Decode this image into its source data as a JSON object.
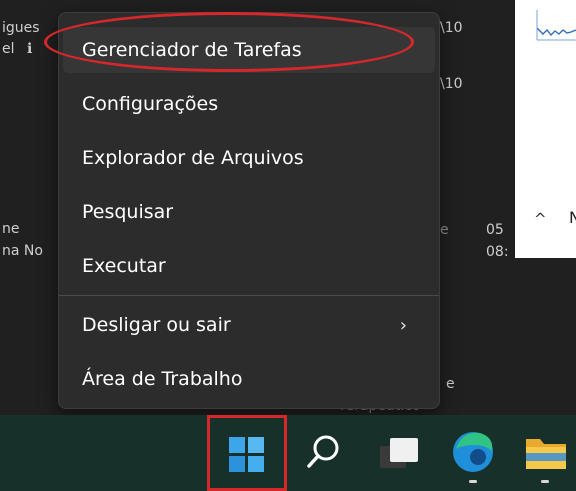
{
  "background": {
    "top_left_lines": [
      "igues",
      "el"
    ],
    "top_left_info_glyph": "ℹ",
    "mid_left_lines": [
      "ne",
      "na No"
    ],
    "path_fragments": [
      "\\10",
      "\\10"
    ],
    "right_fragments": [
      "e",
      "05",
      "08:"
    ],
    "bottom_fragments": [
      "e",
      "rerapeutico >"
    ]
  },
  "side_panel": {
    "chevron": "^",
    "letter": "N"
  },
  "context_menu": {
    "items": [
      {
        "label": "Gerenciador de Tarefas"
      },
      {
        "label": "Configurações"
      },
      {
        "label": "Explorador de Arquivos"
      },
      {
        "label": "Pesquisar"
      },
      {
        "label": "Executar"
      },
      {
        "label": "Desligar ou sair",
        "submenu_chevron": "›"
      },
      {
        "label": "Área de Trabalho"
      }
    ],
    "highlighted_item": "Gerenciador de Tarefas"
  },
  "taskbar": {
    "icons": [
      "windows-start-icon",
      "search-icon",
      "task-view-icon",
      "edge-icon",
      "file-explorer-icon"
    ]
  },
  "colors": {
    "annotation_red": "#d6272b",
    "menu_bg": "#2c2c2c",
    "taskbar_bg": "#18302a"
  }
}
